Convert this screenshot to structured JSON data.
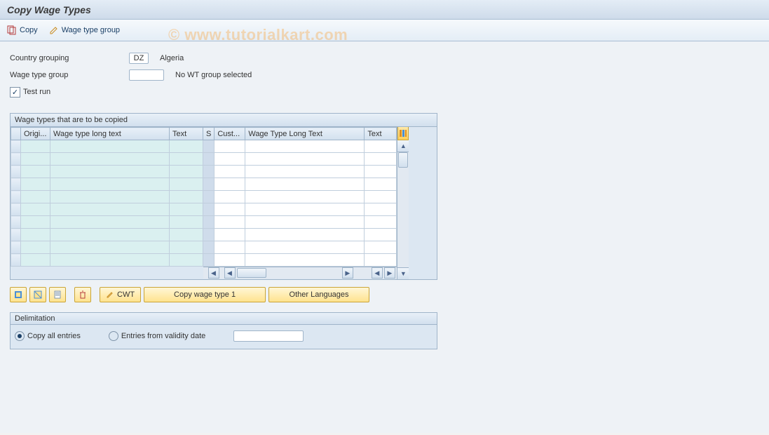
{
  "title": "Copy Wage Types",
  "toolbar": {
    "copy": "Copy",
    "wage_type_group": "Wage type group"
  },
  "watermark": "© www.tutorialkart.com",
  "form": {
    "country_label": "Country grouping",
    "country_value": "DZ",
    "country_name": "Algeria",
    "group_label": "Wage type group",
    "group_value": "",
    "group_note": "No WT group selected",
    "test_run_label": "Test run",
    "test_run_checked": true
  },
  "grid": {
    "title": "Wage types that are to be copied",
    "cols_left": [
      "Origi...",
      "Wage type long text",
      "Text"
    ],
    "cols_right": [
      "S",
      "Cust...",
      "Wage Type Long Text",
      "Text"
    ],
    "rows": 10
  },
  "buttons": {
    "cwt": "CWT",
    "copy1": "Copy wage type 1",
    "other_lang": "Other Languages"
  },
  "delim": {
    "title": "Delimitation",
    "opt_all": "Copy all entries",
    "opt_from": "Entries from validity date",
    "selected": "all",
    "date_value": ""
  }
}
